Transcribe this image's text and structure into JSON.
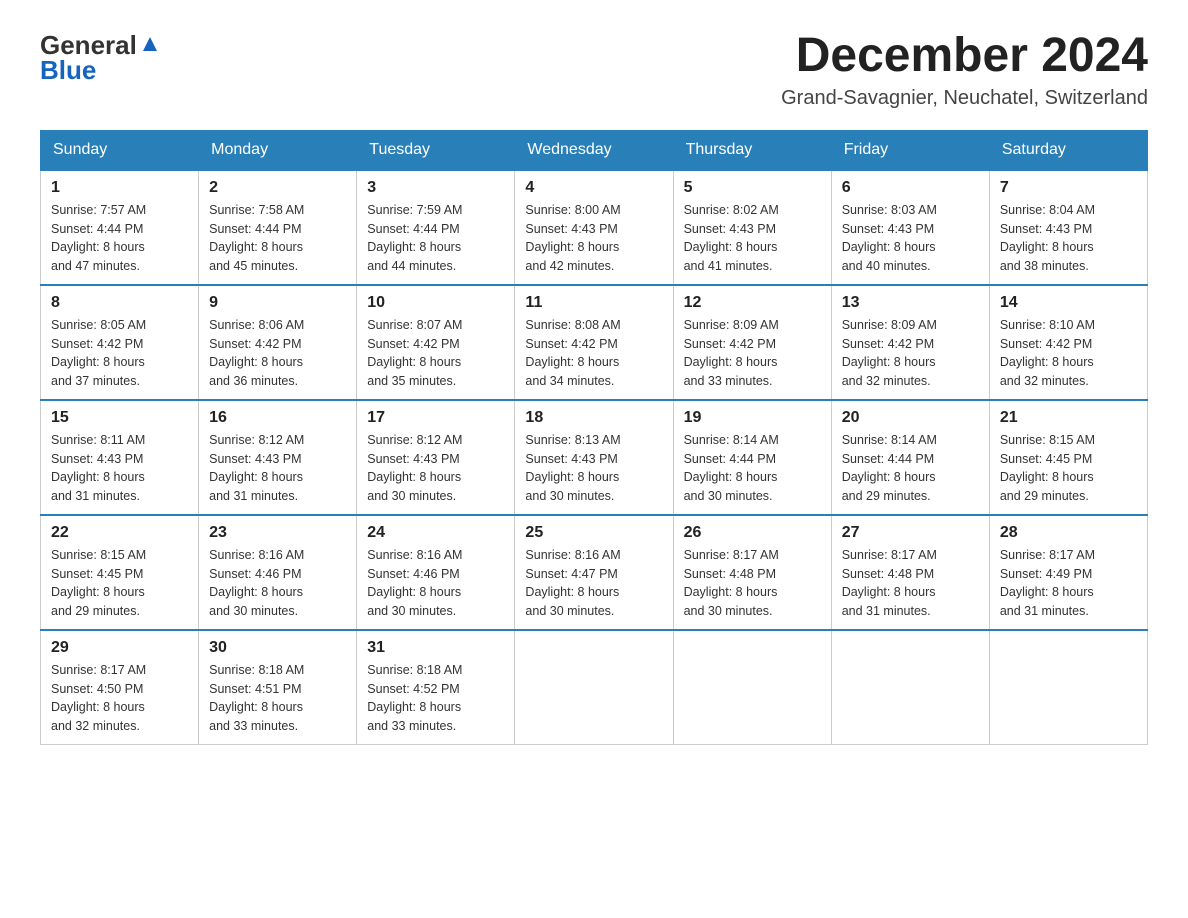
{
  "header": {
    "logo": {
      "text_general": "General",
      "text_blue": "Blue",
      "alt": "GeneralBlue Logo"
    },
    "title": "December 2024",
    "location": "Grand-Savagnier, Neuchatel, Switzerland"
  },
  "weekdays": [
    "Sunday",
    "Monday",
    "Tuesday",
    "Wednesday",
    "Thursday",
    "Friday",
    "Saturday"
  ],
  "weeks": [
    [
      {
        "day": "1",
        "sunrise": "7:57 AM",
        "sunset": "4:44 PM",
        "daylight": "8 hours and 47 minutes."
      },
      {
        "day": "2",
        "sunrise": "7:58 AM",
        "sunset": "4:44 PM",
        "daylight": "8 hours and 45 minutes."
      },
      {
        "day": "3",
        "sunrise": "7:59 AM",
        "sunset": "4:44 PM",
        "daylight": "8 hours and 44 minutes."
      },
      {
        "day": "4",
        "sunrise": "8:00 AM",
        "sunset": "4:43 PM",
        "daylight": "8 hours and 42 minutes."
      },
      {
        "day": "5",
        "sunrise": "8:02 AM",
        "sunset": "4:43 PM",
        "daylight": "8 hours and 41 minutes."
      },
      {
        "day": "6",
        "sunrise": "8:03 AM",
        "sunset": "4:43 PM",
        "daylight": "8 hours and 40 minutes."
      },
      {
        "day": "7",
        "sunrise": "8:04 AM",
        "sunset": "4:43 PM",
        "daylight": "8 hours and 38 minutes."
      }
    ],
    [
      {
        "day": "8",
        "sunrise": "8:05 AM",
        "sunset": "4:42 PM",
        "daylight": "8 hours and 37 minutes."
      },
      {
        "day": "9",
        "sunrise": "8:06 AM",
        "sunset": "4:42 PM",
        "daylight": "8 hours and 36 minutes."
      },
      {
        "day": "10",
        "sunrise": "8:07 AM",
        "sunset": "4:42 PM",
        "daylight": "8 hours and 35 minutes."
      },
      {
        "day": "11",
        "sunrise": "8:08 AM",
        "sunset": "4:42 PM",
        "daylight": "8 hours and 34 minutes."
      },
      {
        "day": "12",
        "sunrise": "8:09 AM",
        "sunset": "4:42 PM",
        "daylight": "8 hours and 33 minutes."
      },
      {
        "day": "13",
        "sunrise": "8:09 AM",
        "sunset": "4:42 PM",
        "daylight": "8 hours and 32 minutes."
      },
      {
        "day": "14",
        "sunrise": "8:10 AM",
        "sunset": "4:42 PM",
        "daylight": "8 hours and 32 minutes."
      }
    ],
    [
      {
        "day": "15",
        "sunrise": "8:11 AM",
        "sunset": "4:43 PM",
        "daylight": "8 hours and 31 minutes."
      },
      {
        "day": "16",
        "sunrise": "8:12 AM",
        "sunset": "4:43 PM",
        "daylight": "8 hours and 31 minutes."
      },
      {
        "day": "17",
        "sunrise": "8:12 AM",
        "sunset": "4:43 PM",
        "daylight": "8 hours and 30 minutes."
      },
      {
        "day": "18",
        "sunrise": "8:13 AM",
        "sunset": "4:43 PM",
        "daylight": "8 hours and 30 minutes."
      },
      {
        "day": "19",
        "sunrise": "8:14 AM",
        "sunset": "4:44 PM",
        "daylight": "8 hours and 30 minutes."
      },
      {
        "day": "20",
        "sunrise": "8:14 AM",
        "sunset": "4:44 PM",
        "daylight": "8 hours and 29 minutes."
      },
      {
        "day": "21",
        "sunrise": "8:15 AM",
        "sunset": "4:45 PM",
        "daylight": "8 hours and 29 minutes."
      }
    ],
    [
      {
        "day": "22",
        "sunrise": "8:15 AM",
        "sunset": "4:45 PM",
        "daylight": "8 hours and 29 minutes."
      },
      {
        "day": "23",
        "sunrise": "8:16 AM",
        "sunset": "4:46 PM",
        "daylight": "8 hours and 30 minutes."
      },
      {
        "day": "24",
        "sunrise": "8:16 AM",
        "sunset": "4:46 PM",
        "daylight": "8 hours and 30 minutes."
      },
      {
        "day": "25",
        "sunrise": "8:16 AM",
        "sunset": "4:47 PM",
        "daylight": "8 hours and 30 minutes."
      },
      {
        "day": "26",
        "sunrise": "8:17 AM",
        "sunset": "4:48 PM",
        "daylight": "8 hours and 30 minutes."
      },
      {
        "day": "27",
        "sunrise": "8:17 AM",
        "sunset": "4:48 PM",
        "daylight": "8 hours and 31 minutes."
      },
      {
        "day": "28",
        "sunrise": "8:17 AM",
        "sunset": "4:49 PM",
        "daylight": "8 hours and 31 minutes."
      }
    ],
    [
      {
        "day": "29",
        "sunrise": "8:17 AM",
        "sunset": "4:50 PM",
        "daylight": "8 hours and 32 minutes."
      },
      {
        "day": "30",
        "sunrise": "8:18 AM",
        "sunset": "4:51 PM",
        "daylight": "8 hours and 33 minutes."
      },
      {
        "day": "31",
        "sunrise": "8:18 AM",
        "sunset": "4:52 PM",
        "daylight": "8 hours and 33 minutes."
      },
      null,
      null,
      null,
      null
    ]
  ],
  "labels": {
    "sunrise": "Sunrise:",
    "sunset": "Sunset:",
    "daylight": "Daylight:"
  }
}
